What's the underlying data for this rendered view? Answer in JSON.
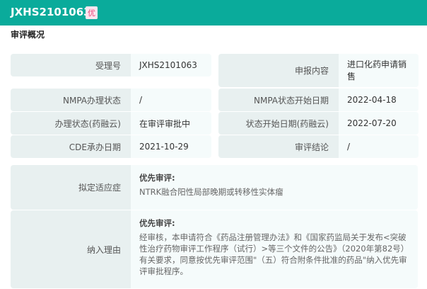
{
  "header": {
    "title": "JXHS2101063",
    "badge": "优"
  },
  "section_title": "审评概况",
  "left": [
    {
      "label": "受理号",
      "value": "JXHS2101063"
    },
    {
      "label": "NMPA办理状态",
      "value": "/"
    },
    {
      "label": "办理状态(药融云)",
      "value": "在审评审批中"
    },
    {
      "label": "CDE承办日期",
      "value": "2021-10-29"
    }
  ],
  "right": [
    {
      "label": "申报内容",
      "value": "进口化药申请销售"
    },
    {
      "label": "NMPA状态开始日期",
      "value": "2022-04-18"
    },
    {
      "label": "状态开始日期(药融云)",
      "value": "2022-07-20"
    },
    {
      "label": "审评结论",
      "value": "/"
    }
  ],
  "indication": {
    "label": "拟定适应症",
    "heading": "优先审评:",
    "text": "NTRK融合阳性局部晚期或转移性实体瘤"
  },
  "reason": {
    "label": "纳入理由",
    "heading": "优先审评:",
    "text": "经审核，本申请符合《药品注册管理办法》和《国家药监局关于发布<突破性治疗药物审评工作程序（试行）>等三个文件的公告》（2020年第82号）有关要求，同意按优先审评范围\"（五）符合附条件批准的药品\"纳入优先审评审批程序。"
  }
}
